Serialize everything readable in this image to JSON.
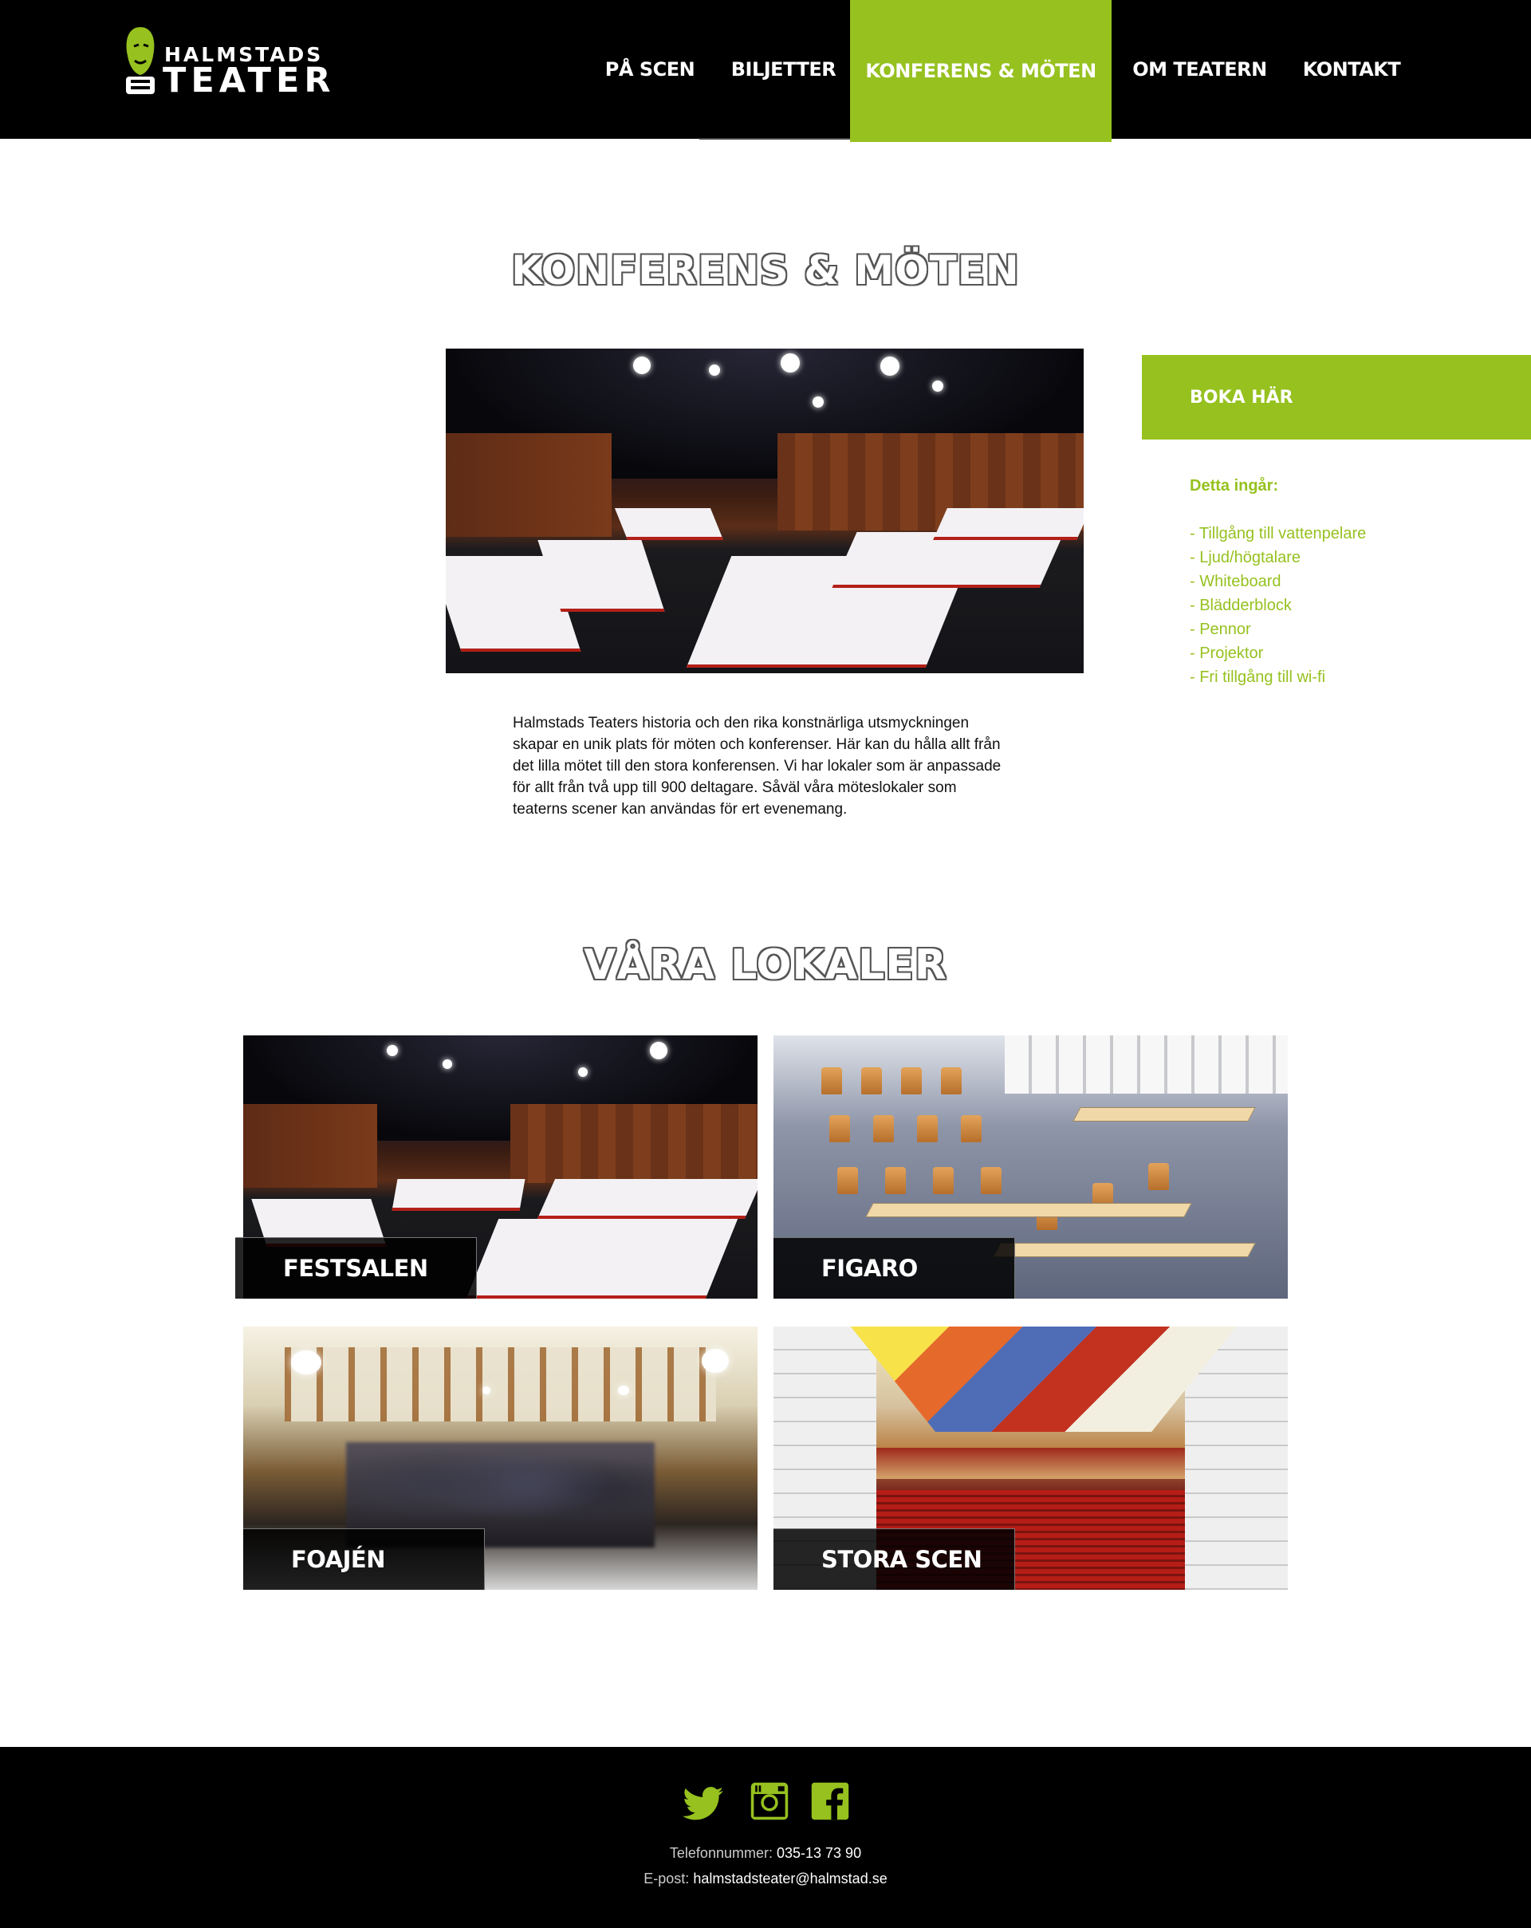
{
  "brand": {
    "line1": "HALMSTADS",
    "line2": "TEATER",
    "accent_color": "#96c11f",
    "header_bg": "#000000"
  },
  "nav": {
    "items": [
      "På scen",
      "Biljetter",
      "Konferens & möten",
      "Om teatern",
      "Kontakt"
    ],
    "active_index": 2
  },
  "page": {
    "title": "Konferens & möten",
    "hero_alt": "Festsalen dukad för konferens",
    "intro": "Halmstads Teaters historia och den rika konstnärliga utsmyckningen skapar en unik plats för möten och konferenser. Här kan du hålla allt från det lilla mötet till den stora konferensen. Vi har lokaler som är anpassade för allt från två upp till 900 deltagare. Såväl våra möteslokaler som teaterns scener kan användas för ert evenemang."
  },
  "sidebar": {
    "book_label": "Boka här",
    "includes_title": "Detta ingår:",
    "includes": [
      "- Tillgång till vattenpelare",
      "- Ljud/högtalare",
      "- Whiteboard",
      "- Blädderblock",
      "- Pennor",
      "- Projektor",
      "- Fri tillgång till wi-fi"
    ]
  },
  "venues": {
    "title": "Våra lokaler",
    "items": [
      "Festsalen",
      "Figaro",
      "Foajén",
      "Stora scen"
    ]
  },
  "footer": {
    "icons": [
      "twitter-icon",
      "instagram-icon",
      "facebook-icon"
    ],
    "phone_label": "Telefonnummer:",
    "phone": "035-13 73 90",
    "email_label": "E-post:",
    "email": "halmstadsteater@halmstad.se"
  }
}
